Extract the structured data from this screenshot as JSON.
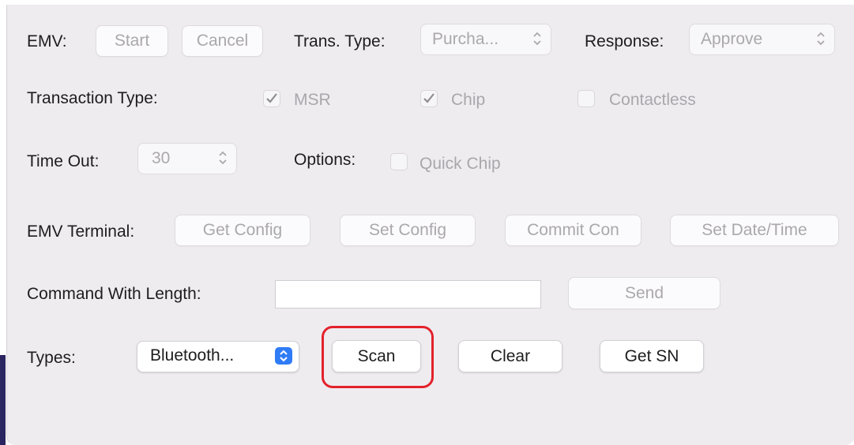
{
  "emv": {
    "label": "EMV:",
    "start": "Start",
    "cancel": "Cancel"
  },
  "trans_type": {
    "label": "Trans. Type:",
    "value": "Purcha..."
  },
  "response": {
    "label": "Response:",
    "value": "Approve"
  },
  "transaction_type": {
    "label": "Transaction Type:",
    "options": [
      {
        "label": "MSR",
        "checked": true
      },
      {
        "label": "Chip",
        "checked": true
      },
      {
        "label": "Contactless",
        "checked": false
      }
    ]
  },
  "timeout": {
    "label": "Time Out:",
    "value": "30"
  },
  "options": {
    "label": "Options:",
    "quick_chip": "Quick Chip",
    "quick_chip_checked": false
  },
  "emv_terminal": {
    "label": "EMV Terminal:",
    "get_config": "Get Config",
    "set_config": "Set Config",
    "commit": "Commit Con",
    "set_datetime": "Set Date/Time"
  },
  "command": {
    "label": "Command With Length:",
    "value": "",
    "send": "Send"
  },
  "types": {
    "label": "Types:",
    "value": "Bluetooth..."
  },
  "actions": {
    "scan": "Scan",
    "clear": "Clear",
    "get_sn": "Get SN"
  },
  "colors": {
    "accent": "#2f7cf6",
    "highlight": "#e3222b"
  }
}
